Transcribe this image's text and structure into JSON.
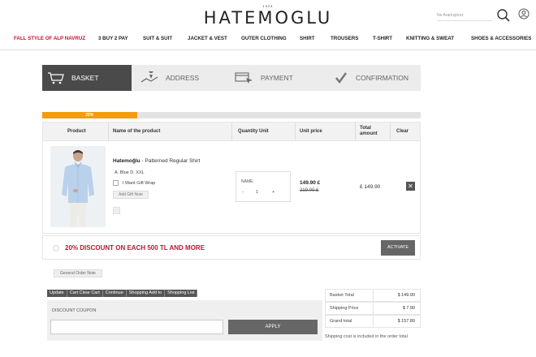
{
  "header": {
    "logo_year": "1924",
    "logo": "HATEMOGLU",
    "search_placeholder": "Ne Aramıştınız"
  },
  "nav": [
    "FALL STYLE OF ALP NAVRUZ",
    "3 BUY 2 PAY",
    "SUIT & SUIT",
    "JACKET & VEST",
    "OUTER CLOTHING",
    "SHIRT",
    "TROUSERS",
    "T-SHIRT",
    "KNITTING & SWEAT",
    "SHOES & ACCESSORIES"
  ],
  "steps": [
    {
      "label": "BASKET",
      "icon": "basket-icon",
      "active": true
    },
    {
      "label": "ADDRESS",
      "icon": "map-pin-icon",
      "active": false
    },
    {
      "label": "PAYMENT",
      "icon": "payment-icon",
      "active": false
    },
    {
      "label": "CONFIRMATION",
      "icon": "confirmation-check-icon",
      "active": false
    }
  ],
  "progress": {
    "percent": 25,
    "label": "25%"
  },
  "table": {
    "headers": {
      "product": "Product",
      "name": "Name of the product",
      "qty": "Quantity Unit",
      "unit_price": "Unit price",
      "total": "Total amount",
      "clear": "Clear"
    }
  },
  "item": {
    "brand": "Hatemoğlu",
    "separator": "-",
    "name": "Patterned Regular Shirt",
    "variant": "A. Blue D. XXL",
    "gift_wrap_label": "I Want Gift Wrap",
    "gift_note_label": "Add Gift Note",
    "qty_name_label": "NAME:",
    "qty_minus": "-",
    "qty_value": "1",
    "qty_plus": "+",
    "price_now": "149.90 £",
    "price_old": "219.00 £",
    "total": "£ 149.90",
    "remove_symbol": "✕"
  },
  "discount": {
    "text": "20% DISCOUNT ON EACH 500 TL AND MORE",
    "button": "ACTIVATE"
  },
  "order_note_label": "General Order Note",
  "actions": [
    "Update",
    "Cart Clear Cart",
    "Continue",
    "Shopping Add to",
    "Shopping List"
  ],
  "coupon": {
    "title": "DISCOUNT COUPON",
    "input_value": "",
    "apply_label": "APPLY"
  },
  "summary": {
    "rows": [
      {
        "label": "Basket Total",
        "value": "$ 149.90"
      },
      {
        "label": "Shipping Price",
        "value": "$ 7.90"
      },
      {
        "label": "Grand total",
        "value": "$ 157.80"
      }
    ],
    "shipping_note": "Shipping cost is included in the order total"
  },
  "colors": {
    "accent_red": "#c8102e",
    "progress_orange": "#f39c12",
    "dark_step": "#4a4a4a",
    "button_grey": "#666666"
  }
}
